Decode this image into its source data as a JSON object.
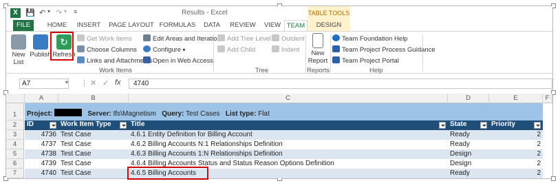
{
  "window": {
    "title": "Results - Excel",
    "table_tools_label": "TABLE TOOLS"
  },
  "tabs": [
    {
      "label": "FILE"
    },
    {
      "label": "HOME"
    },
    {
      "label": "INSERT"
    },
    {
      "label": "PAGE LAYOUT"
    },
    {
      "label": "FORMULAS"
    },
    {
      "label": "DATA"
    },
    {
      "label": "REVIEW"
    },
    {
      "label": "VIEW"
    },
    {
      "label": "TEAM"
    },
    {
      "label": "DESIGN"
    }
  ],
  "ribbon": {
    "new_list": "New List",
    "new_list_l1": "New",
    "new_list_l2": "List",
    "publish": "Publish",
    "refresh": "Refresh",
    "get_work_items": "Get Work Items",
    "choose_columns": "Choose Columns",
    "links_attachments": "Links and Attachments",
    "edit_areas": "Edit Areas and Iterations",
    "configure": "Configure",
    "open_web_access": "Open in Web Access",
    "group_work_items": "Work Items",
    "add_tree_level": "Add Tree Level",
    "add_child": "Add Child",
    "outdent": "Outdent",
    "indent": "Indent",
    "group_tree": "Tree",
    "new_report_l1": "New",
    "new_report_l2": "Report",
    "group_reports": "Reports",
    "tf_help": "Team Foundation Help",
    "process_guidance": "Team Project Process Guidance",
    "project_portal": "Team Project Portal",
    "group_help": "Help"
  },
  "formula_bar": {
    "name_box": "A7",
    "fx": "fx",
    "value": "4740"
  },
  "columns": [
    "A",
    "B",
    "C",
    "D",
    "E",
    "F"
  ],
  "row_numbers": [
    "1",
    "2",
    "3",
    "4",
    "5",
    "6",
    "7"
  ],
  "info_row": {
    "project_label": "Project:",
    "server_label": "Server:",
    "server_value": "tfs\\Magnetism",
    "query_label": "Query:",
    "query_value": "Test Cases",
    "list_type_label": "List type:",
    "list_type_value": "Flat"
  },
  "table": {
    "headers": [
      "ID",
      "Work Item Type",
      "Title",
      "State",
      "Priority"
    ],
    "rows": [
      {
        "id": "4736",
        "type": "Test Case",
        "title": "4.6.1 Entity Definition for Billing Account",
        "state": "Ready",
        "priority": "2"
      },
      {
        "id": "4737",
        "type": "Test Case",
        "title": "4.6.2 Billing Accounts N:1 Relationships Definition",
        "state": "Ready",
        "priority": "2"
      },
      {
        "id": "4738",
        "type": "Test Case",
        "title": "4.6.3 Billing Accounts 1:N Relationships Definition",
        "state": "Design",
        "priority": "2"
      },
      {
        "id": "4739",
        "type": "Test Case",
        "title": "4.6.4 Billing Accounts Status and Status Reason Options Definition",
        "state": "Design",
        "priority": "2"
      },
      {
        "id": "4740",
        "type": "Test Case",
        "title": "4.6.5 Billing Accounts",
        "state": "Ready",
        "priority": "2"
      }
    ]
  },
  "colors": {
    "excel_green": "#217346",
    "header_blue": "#1f4e79",
    "info_row": "#9dc3e6",
    "band_light": "#dce6f1",
    "highlight_red": "#d00000"
  }
}
